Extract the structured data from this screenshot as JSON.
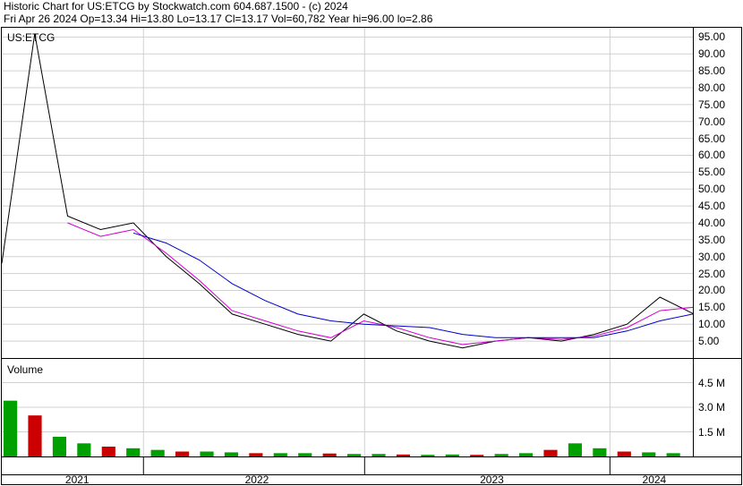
{
  "header": {
    "title": "Historic Chart for US:ETCG by Stockwatch.com 604.687.1500 - (c) 2024",
    "quote": "Fri Apr 26 2024  Op=13.34  Hi=13.80  Lo=13.17  Cl=13.17  Vol=60,782  Year hi=96.00  lo=2.86"
  },
  "chart_data": [
    {
      "type": "line",
      "title": "US:ETCG",
      "ylim": [
        0,
        98
      ],
      "y_ticks": [
        "95.00",
        "90.00",
        "85.00",
        "80.00",
        "75.00",
        "70.00",
        "65.00",
        "60.00",
        "55.00",
        "50.00",
        "45.00",
        "40.00",
        "35.00",
        "30.00",
        "25.00",
        "20.00",
        "15.00",
        "10.00",
        "5.00"
      ],
      "grid": true,
      "x": [
        "2020-12",
        "2021-01",
        "2021-03",
        "2021-05",
        "2021-07",
        "2021-09",
        "2021-11",
        "2022-01",
        "2022-03",
        "2022-05",
        "2022-07",
        "2022-09",
        "2022-11",
        "2023-01",
        "2023-03",
        "2023-05",
        "2023-07",
        "2023-09",
        "2023-11",
        "2024-01",
        "2024-03",
        "2024-04"
      ],
      "series": [
        {
          "values": [
            28,
            96,
            42,
            38,
            40,
            30,
            22,
            13,
            10,
            7,
            5,
            13,
            8,
            5,
            3,
            5,
            6,
            5,
            7,
            10,
            18,
            13.17
          ]
        },
        {
          "values": [
            null,
            null,
            40,
            36,
            38,
            31,
            23,
            14,
            11,
            8,
            6,
            11,
            9,
            6,
            4,
            5,
            6,
            5.5,
            6.5,
            9,
            14,
            15
          ]
        },
        {
          "values": [
            null,
            null,
            null,
            null,
            37,
            34,
            29,
            22,
            17,
            13,
            11,
            10,
            9.5,
            9,
            7,
            6,
            6,
            6,
            6,
            8,
            11,
            13
          ]
        }
      ]
    },
    {
      "type": "bar",
      "title": "Volume",
      "y_ticks": [
        "4.5 M",
        "3.0 M",
        "1.5 M"
      ],
      "ylim": [
        0,
        6
      ],
      "x_ticks": [
        "2021",
        "2022",
        "2023",
        "2024"
      ],
      "note_values_in_millions": true,
      "values": [
        3.4,
        2.5,
        1.2,
        0.8,
        0.6,
        0.5,
        0.4,
        0.3,
        0.3,
        0.25,
        0.2,
        0.2,
        0.2,
        0.18,
        0.15,
        0.15,
        0.12,
        0.1,
        0.12,
        0.1,
        0.15,
        0.2,
        0.4,
        0.8,
        0.5,
        0.3,
        0.25,
        0.2
      ]
    }
  ]
}
